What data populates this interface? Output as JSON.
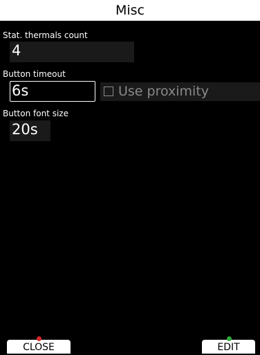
{
  "window": {
    "title": "Misc"
  },
  "settings": {
    "thermals": {
      "label": "Stat. thermals count",
      "value": "4"
    },
    "button_timeout": {
      "label": "Button timeout",
      "value": "6s"
    },
    "use_proximity": {
      "label": "Use proximity",
      "checked": false
    },
    "button_font_size": {
      "label": "Button font size",
      "value": "20s"
    }
  },
  "footer": {
    "close_label": "CLOSE",
    "edit_label": "EDIT"
  },
  "colors": {
    "background": "#000000",
    "title_bar": "#ffffff",
    "field_bg": "#1a1a1a",
    "disabled_text": "#8a8a8a",
    "close_indicator": "#d8282a",
    "edit_indicator": "#2ea83a"
  }
}
